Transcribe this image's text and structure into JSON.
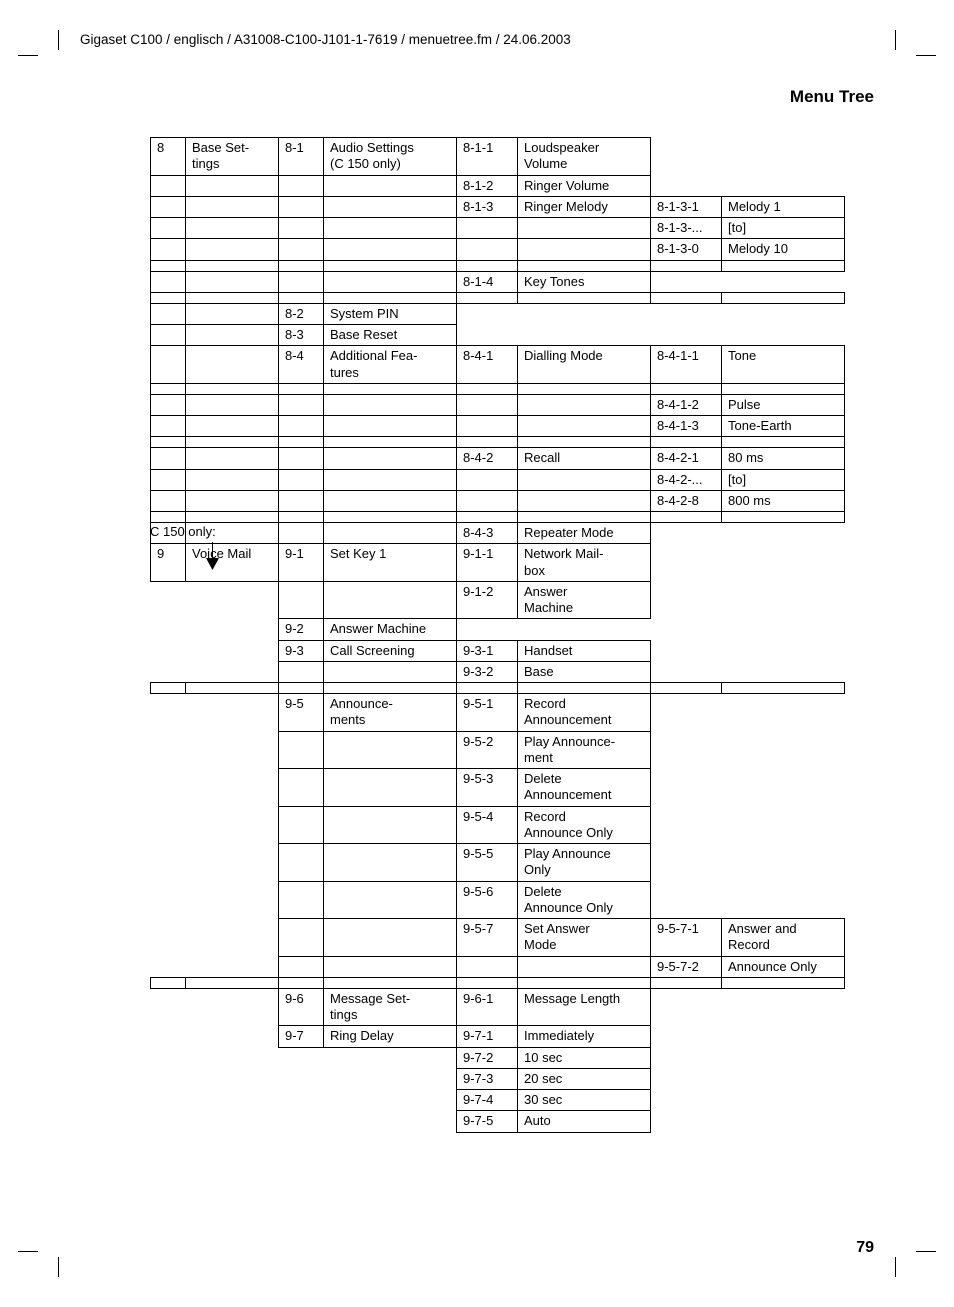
{
  "header": "Gigaset C100 / englisch / A31008-C100-J101-1-7619 / menuetree.fm / 24.06.2003",
  "section_title": "Menu Tree",
  "page_number": "79",
  "note_c150": "C 150 only:",
  "rows": [
    {
      "c": [
        "8",
        "Base Set-\ntings",
        "8-1",
        "Audio Settings\n(C 150 only)",
        "8-1-1",
        "Loudspeaker\nVolume",
        "",
        ""
      ],
      "b": [
        1,
        1,
        1,
        1,
        1,
        1,
        0,
        0
      ]
    },
    {
      "c": [
        "",
        "",
        "",
        "",
        "8-1-2",
        "Ringer Volume",
        "",
        ""
      ],
      "b": [
        1,
        1,
        1,
        1,
        1,
        1,
        0,
        0
      ],
      "tb": [
        "nt",
        "nt",
        "nt",
        "nt",
        "",
        "",
        "",
        ""
      ]
    },
    {
      "c": [
        "",
        "",
        "",
        "",
        "8-1-3",
        "Ringer Melody",
        "8-1-3-1",
        "Melody 1"
      ],
      "b": [
        1,
        1,
        1,
        1,
        1,
        1,
        1,
        1
      ],
      "tb": [
        "nt",
        "nt",
        "nt",
        "nt",
        "",
        "",
        "",
        ""
      ]
    },
    {
      "c": [
        "",
        "",
        "",
        "",
        "",
        "",
        "8-1-3-...",
        "[to]"
      ],
      "b": [
        1,
        1,
        1,
        1,
        1,
        1,
        1,
        1
      ],
      "tb": [
        "nt",
        "nt",
        "nt",
        "nt",
        "nt",
        "nt",
        "",
        ""
      ]
    },
    {
      "c": [
        "",
        "",
        "",
        "",
        "",
        "",
        "8-1-3-0",
        "Melody 10"
      ],
      "b": [
        1,
        1,
        1,
        1,
        1,
        1,
        1,
        1
      ],
      "tb": [
        "nt",
        "nt",
        "nt",
        "nt",
        "nt",
        "nt",
        "",
        ""
      ]
    },
    {
      "gap": 1,
      "sides": [
        1,
        1,
        1,
        1,
        1,
        1,
        0,
        0
      ]
    },
    {
      "c": [
        "",
        "",
        "",
        "",
        "8-1-4",
        "Key Tones",
        "",
        ""
      ],
      "b": [
        1,
        1,
        1,
        1,
        1,
        1,
        0,
        0
      ],
      "tb": [
        "nt",
        "nt",
        "nt",
        "nt",
        "",
        "",
        "",
        ""
      ]
    },
    {
      "gap": 1,
      "sides": [
        1,
        1,
        1,
        1,
        0,
        0,
        0,
        0
      ]
    },
    {
      "c": [
        "",
        "",
        "8-2",
        "System PIN",
        "",
        "",
        "",
        ""
      ],
      "b": [
        1,
        1,
        1,
        1,
        0,
        0,
        0,
        0
      ],
      "tb": [
        "nt",
        "nt",
        "",
        "",
        "",
        "",
        "",
        ""
      ]
    },
    {
      "c": [
        "",
        "",
        "8-3",
        "Base Reset",
        "",
        "",
        "",
        ""
      ],
      "b": [
        1,
        1,
        1,
        1,
        0,
        0,
        0,
        0
      ],
      "tb": [
        "nt",
        "nt",
        "",
        "",
        "",
        "",
        "",
        ""
      ]
    },
    {
      "c": [
        "",
        "",
        "8-4",
        "Additional Fea-\ntures",
        "8-4-1",
        "Dialling Mode",
        "8-4-1-1",
        "Tone"
      ],
      "b": [
        1,
        1,
        1,
        1,
        1,
        1,
        1,
        1
      ],
      "tb": [
        "nt",
        "nt",
        "",
        "",
        "",
        "",
        "",
        ""
      ]
    },
    {
      "gap": 1,
      "sides": [
        1,
        1,
        1,
        1,
        1,
        1,
        0,
        0
      ]
    },
    {
      "c": [
        "",
        "",
        "",
        "",
        "",
        "",
        "8-4-1-2",
        "Pulse"
      ],
      "b": [
        1,
        1,
        1,
        1,
        1,
        1,
        1,
        1
      ],
      "tb": [
        "nt",
        "nt",
        "nt",
        "nt",
        "nt",
        "nt",
        "",
        ""
      ]
    },
    {
      "c": [
        "",
        "",
        "",
        "",
        "",
        "",
        "8-4-1-3",
        "Tone-Earth"
      ],
      "b": [
        1,
        1,
        1,
        1,
        1,
        1,
        1,
        1
      ],
      "tb": [
        "nt",
        "nt",
        "nt",
        "nt",
        "nt",
        "nt",
        "",
        ""
      ]
    },
    {
      "gap": 1,
      "sides": [
        1,
        1,
        1,
        1,
        1,
        1,
        0,
        0
      ]
    },
    {
      "c": [
        "",
        "",
        "",
        "",
        "8-4-2",
        "Recall",
        "8-4-2-1",
        "80 ms"
      ],
      "b": [
        1,
        1,
        1,
        1,
        1,
        1,
        1,
        1
      ],
      "tb": [
        "nt",
        "nt",
        "nt",
        "nt",
        "",
        "",
        "",
        ""
      ]
    },
    {
      "c": [
        "",
        "",
        "",
        "",
        "",
        "",
        "8-4-2-...",
        "[to]"
      ],
      "b": [
        1,
        1,
        1,
        1,
        1,
        1,
        1,
        1
      ],
      "tb": [
        "nt",
        "nt",
        "nt",
        "nt",
        "nt",
        "nt",
        "",
        ""
      ]
    },
    {
      "c": [
        "",
        "",
        "",
        "",
        "",
        "",
        "8-4-2-8",
        "800 ms"
      ],
      "b": [
        1,
        1,
        1,
        1,
        1,
        1,
        1,
        1
      ],
      "tb": [
        "nt",
        "nt",
        "nt",
        "nt",
        "nt",
        "nt",
        "",
        ""
      ]
    },
    {
      "gap": 1,
      "sides": [
        1,
        1,
        1,
        1,
        1,
        1,
        0,
        0
      ]
    },
    {
      "c": [
        "",
        "",
        "",
        "",
        "8-4-3",
        "Repeater Mode",
        "",
        ""
      ],
      "b": [
        1,
        1,
        1,
        1,
        1,
        1,
        0,
        0
      ],
      "tb": [
        "nt",
        "nt",
        "nt",
        "nt",
        "",
        "",
        "",
        ""
      ]
    },
    {
      "c": [
        "9",
        "Voice Mail",
        "9-1",
        "Set Key 1",
        "9-1-1",
        "Network Mail-\nbox",
        "",
        ""
      ],
      "b": [
        1,
        1,
        1,
        1,
        1,
        1,
        0,
        0
      ]
    },
    {
      "c": [
        "",
        "",
        "",
        "",
        "9-1-2",
        "Answer\nMachine",
        "",
        ""
      ],
      "b": [
        0,
        0,
        1,
        1,
        1,
        1,
        0,
        0
      ],
      "tb": [
        "",
        "",
        "nt",
        "nt",
        "",
        "",
        "",
        ""
      ]
    },
    {
      "c": [
        "",
        "",
        "9-2",
        "Answer Machine",
        "",
        "",
        "",
        ""
      ],
      "b": [
        0,
        0,
        1,
        1,
        0,
        0,
        0,
        0
      ]
    },
    {
      "c": [
        "",
        "",
        "9-3",
        "Call Screening",
        "9-3-1",
        "Handset",
        "",
        ""
      ],
      "b": [
        0,
        0,
        1,
        1,
        1,
        1,
        0,
        0
      ]
    },
    {
      "c": [
        "",
        "",
        "",
        "",
        "9-3-2",
        "Base",
        "",
        ""
      ],
      "b": [
        0,
        0,
        1,
        1,
        1,
        1,
        0,
        0
      ],
      "tb": [
        "",
        "",
        "nt",
        "nt",
        "",
        "",
        "",
        ""
      ]
    },
    {
      "gap": 1,
      "sides": [
        0,
        0,
        1,
        1,
        0,
        0,
        0,
        0
      ]
    },
    {
      "c": [
        "",
        "",
        "9-5",
        "Announce-\nments",
        "9-5-1",
        "Record\nAnnouncement",
        "",
        ""
      ],
      "b": [
        0,
        0,
        1,
        1,
        1,
        1,
        0,
        0
      ]
    },
    {
      "c": [
        "",
        "",
        "",
        "",
        "9-5-2",
        "Play Announce-\nment",
        "",
        ""
      ],
      "b": [
        0,
        0,
        1,
        1,
        1,
        1,
        0,
        0
      ],
      "tb": [
        "",
        "",
        "nt",
        "nt",
        "",
        "",
        "",
        ""
      ]
    },
    {
      "c": [
        "",
        "",
        "",
        "",
        "9-5-3",
        "Delete\nAnnouncement",
        "",
        ""
      ],
      "b": [
        0,
        0,
        1,
        1,
        1,
        1,
        0,
        0
      ],
      "tb": [
        "",
        "",
        "nt",
        "nt",
        "",
        "",
        "",
        ""
      ]
    },
    {
      "c": [
        "",
        "",
        "",
        "",
        "9-5-4",
        "Record\nAnnounce Only",
        "",
        ""
      ],
      "b": [
        0,
        0,
        1,
        1,
        1,
        1,
        0,
        0
      ],
      "tb": [
        "",
        "",
        "nt",
        "nt",
        "",
        "",
        "",
        ""
      ]
    },
    {
      "c": [
        "",
        "",
        "",
        "",
        "9-5-5",
        "Play Announce\nOnly",
        "",
        ""
      ],
      "b": [
        0,
        0,
        1,
        1,
        1,
        1,
        0,
        0
      ],
      "tb": [
        "",
        "",
        "nt",
        "nt",
        "",
        "",
        "",
        ""
      ]
    },
    {
      "c": [
        "",
        "",
        "",
        "",
        "9-5-6",
        "Delete\nAnnounce Only",
        "",
        ""
      ],
      "b": [
        0,
        0,
        1,
        1,
        1,
        1,
        0,
        0
      ],
      "tb": [
        "",
        "",
        "nt",
        "nt",
        "",
        "",
        "",
        ""
      ]
    },
    {
      "c": [
        "",
        "",
        "",
        "",
        "9-5-7",
        "Set Answer\nMode",
        "9-5-7-1",
        "Answer and\nRecord"
      ],
      "b": [
        0,
        0,
        1,
        1,
        1,
        1,
        1,
        1
      ],
      "tb": [
        "",
        "",
        "nt",
        "nt",
        "",
        "",
        "",
        ""
      ]
    },
    {
      "c": [
        "",
        "",
        "",
        "",
        "",
        "",
        "9-5-7-2",
        "Announce Only"
      ],
      "b": [
        0,
        0,
        1,
        1,
        1,
        1,
        1,
        1
      ],
      "tb": [
        "",
        "",
        "nt",
        "nt",
        "nt",
        "nt",
        "",
        ""
      ]
    },
    {
      "gap": 1,
      "sides": [
        0,
        0,
        1,
        1,
        0,
        0,
        0,
        0
      ]
    },
    {
      "c": [
        "",
        "",
        "9-6",
        "Message Set-\ntings",
        "9-6-1",
        "Message Length",
        "",
        ""
      ],
      "b": [
        0,
        0,
        1,
        1,
        1,
        1,
        0,
        0
      ]
    },
    {
      "c": [
        "",
        "",
        "9-7",
        "Ring Delay",
        "9-7-1",
        "Immediately",
        "",
        ""
      ],
      "b": [
        0,
        0,
        1,
        1,
        1,
        1,
        0,
        0
      ]
    },
    {
      "c": [
        "",
        "",
        "",
        "",
        "9-7-2",
        "10 sec",
        "",
        ""
      ],
      "b": [
        0,
        0,
        0,
        0,
        1,
        1,
        0,
        0
      ]
    },
    {
      "c": [
        "",
        "",
        "",
        "",
        "9-7-3",
        "20 sec",
        "",
        ""
      ],
      "b": [
        0,
        0,
        0,
        0,
        1,
        1,
        0,
        0
      ]
    },
    {
      "c": [
        "",
        "",
        "",
        "",
        "9-7-4",
        "30 sec",
        "",
        ""
      ],
      "b": [
        0,
        0,
        0,
        0,
        1,
        1,
        0,
        0
      ]
    },
    {
      "c": [
        "",
        "",
        "",
        "",
        "9-7-5",
        "Auto",
        "",
        ""
      ],
      "b": [
        0,
        0,
        0,
        0,
        1,
        1,
        0,
        0
      ]
    }
  ]
}
